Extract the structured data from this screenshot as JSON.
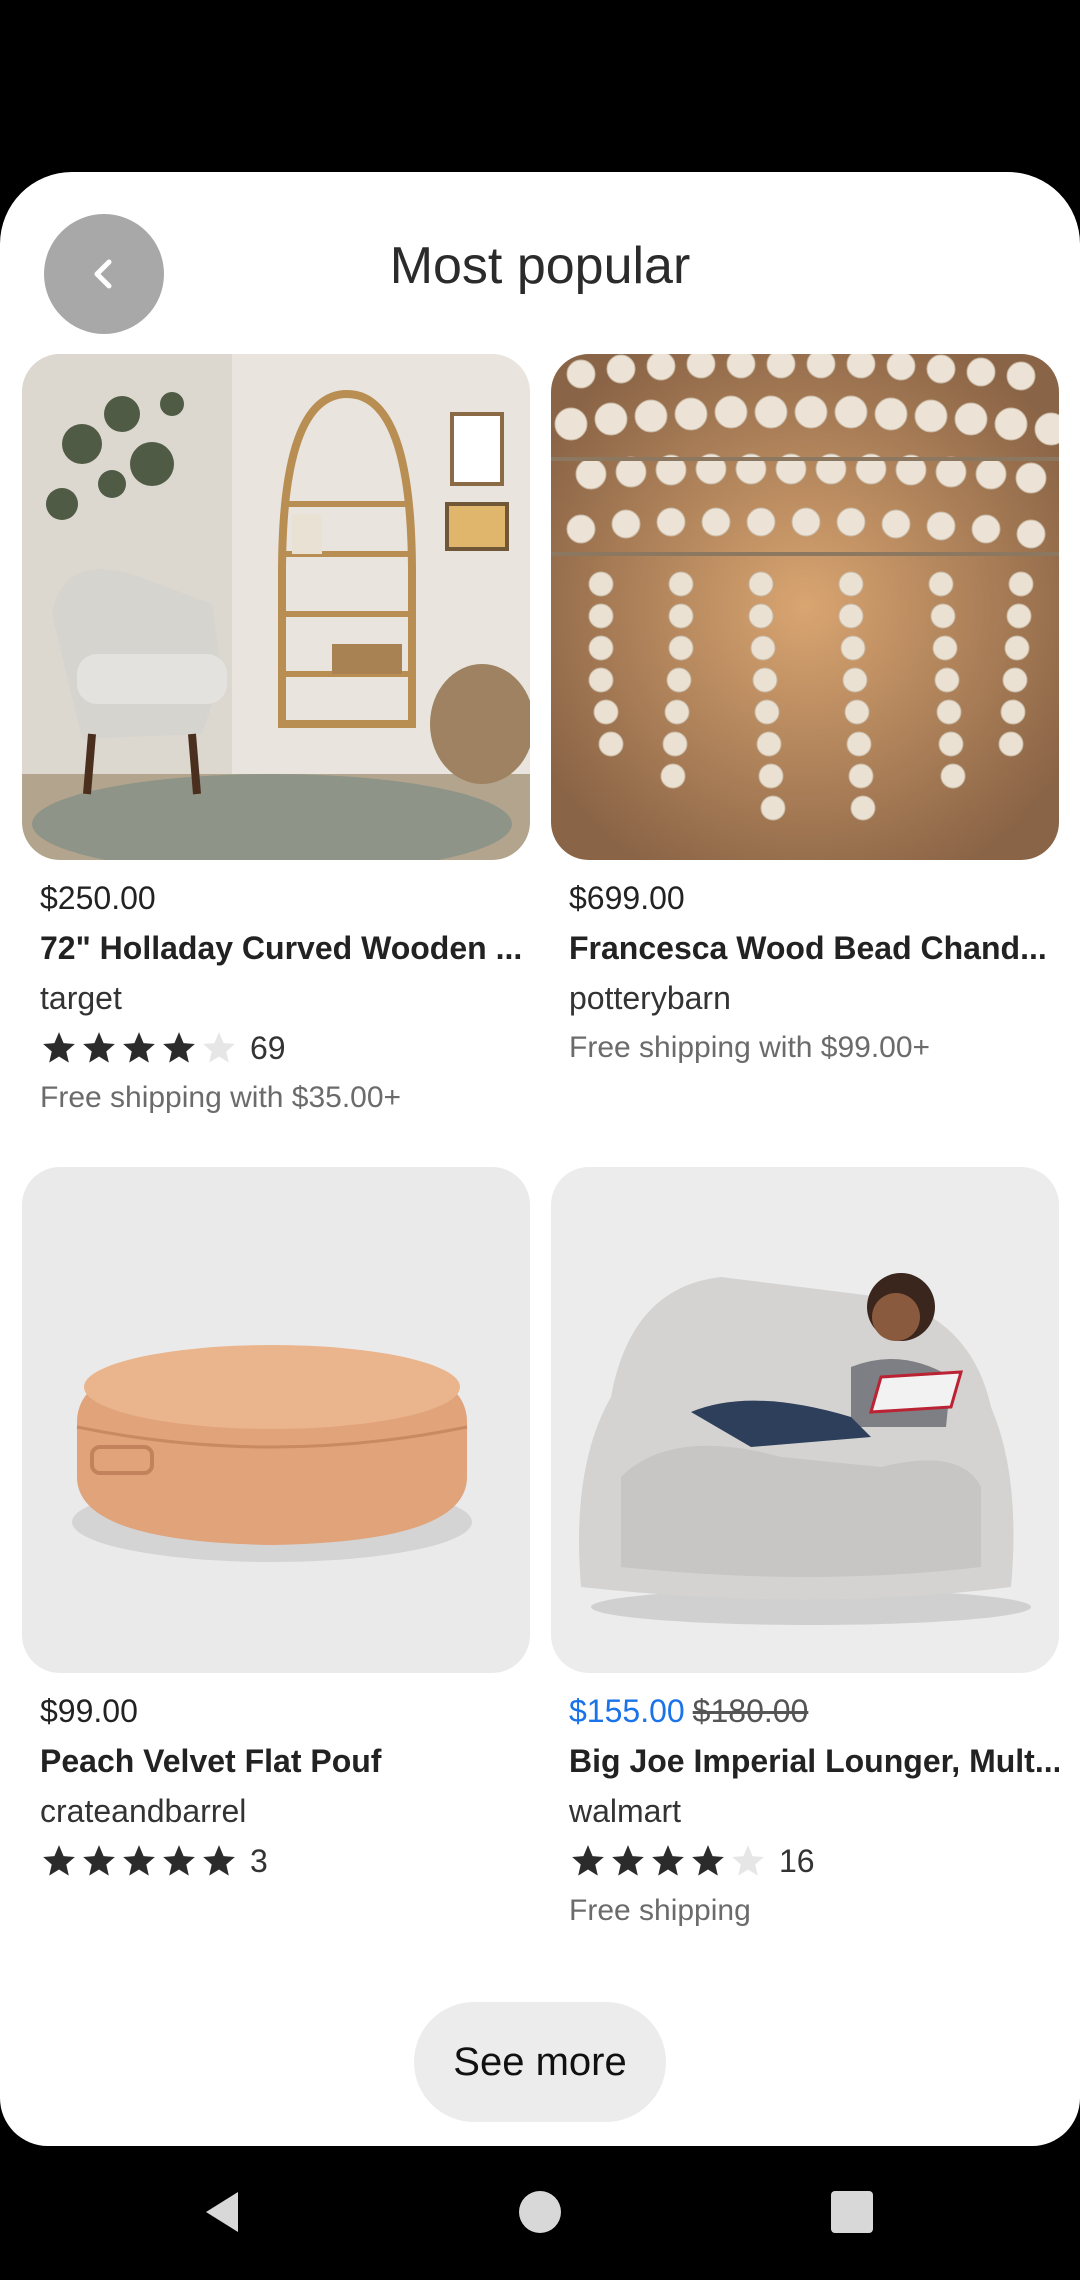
{
  "header": {
    "title": "Most popular",
    "back_icon": "chevron-left-icon"
  },
  "products": [
    {
      "price": "$250.00",
      "name": "72\" Holladay Curved Wooden ...",
      "store": "target",
      "rating_stars": 4,
      "rating_count": "69",
      "shipping": "Free shipping with $35.00+"
    },
    {
      "price": "$699.00",
      "name": "Francesca Wood Bead Chand...",
      "store": "potterybarn",
      "shipping": "Free shipping with $99.00+"
    },
    {
      "price": "$99.00",
      "name": "Peach Velvet Flat Pouf",
      "store": "crateandbarrel",
      "rating_stars": 5,
      "rating_count": "3"
    },
    {
      "sale_price": "$155.00",
      "original_price": "$180.00",
      "name": "Big Joe Imperial Lounger, Mult...",
      "store": "walmart",
      "rating_stars": 4,
      "rating_count": "16",
      "shipping": "Free shipping"
    }
  ],
  "see_more_label": "See more",
  "colors": {
    "sale_price": "#1a73e8",
    "star_filled": "#2b2b2b",
    "star_empty": "#e6e6e6"
  },
  "system_nav": {
    "back_icon": "triangle-back-icon",
    "home_icon": "circle-home-icon",
    "recents_icon": "square-recents-icon"
  }
}
